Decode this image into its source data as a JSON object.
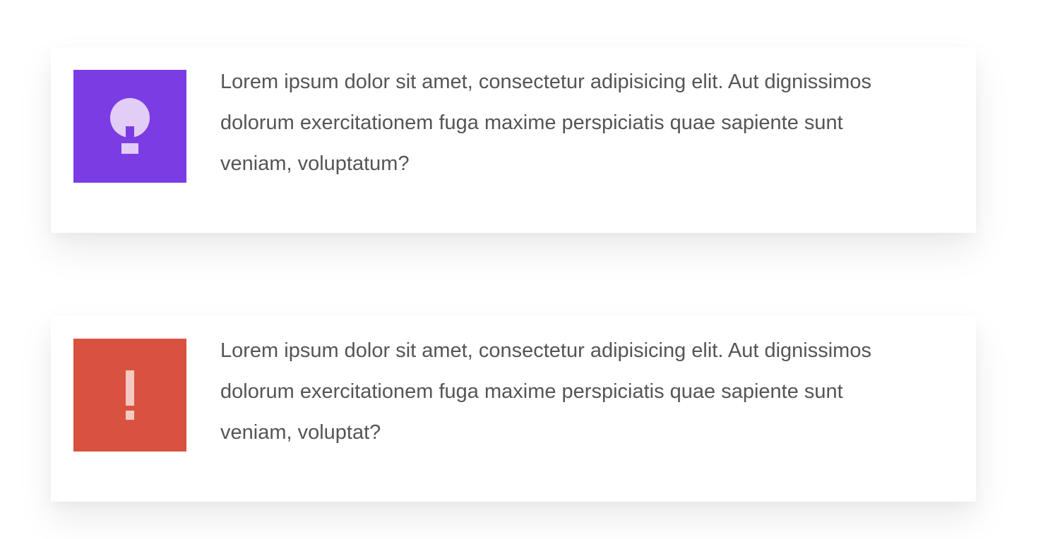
{
  "cards": [
    {
      "icon": "lightbulb-icon",
      "icon_bg": "#7b3ce3",
      "icon_fg": "#e2cdf6",
      "text": "Lorem ipsum dolor sit amet, consectetur adipisicing elit. Aut dignissimos dolorum exercitationem fuga maxime perspiciatis quae sapiente sunt veniam, voluptatum?"
    },
    {
      "icon": "exclamation-icon",
      "icon_bg": "#d9523f",
      "icon_fg": "#f5c9c1",
      "text": "Lorem ipsum dolor sit amet, consectetur adipisicing elit. Aut dignissimos dolorum exercitationem fuga maxime perspiciatis quae sapiente sunt veniam, voluptat?"
    }
  ]
}
